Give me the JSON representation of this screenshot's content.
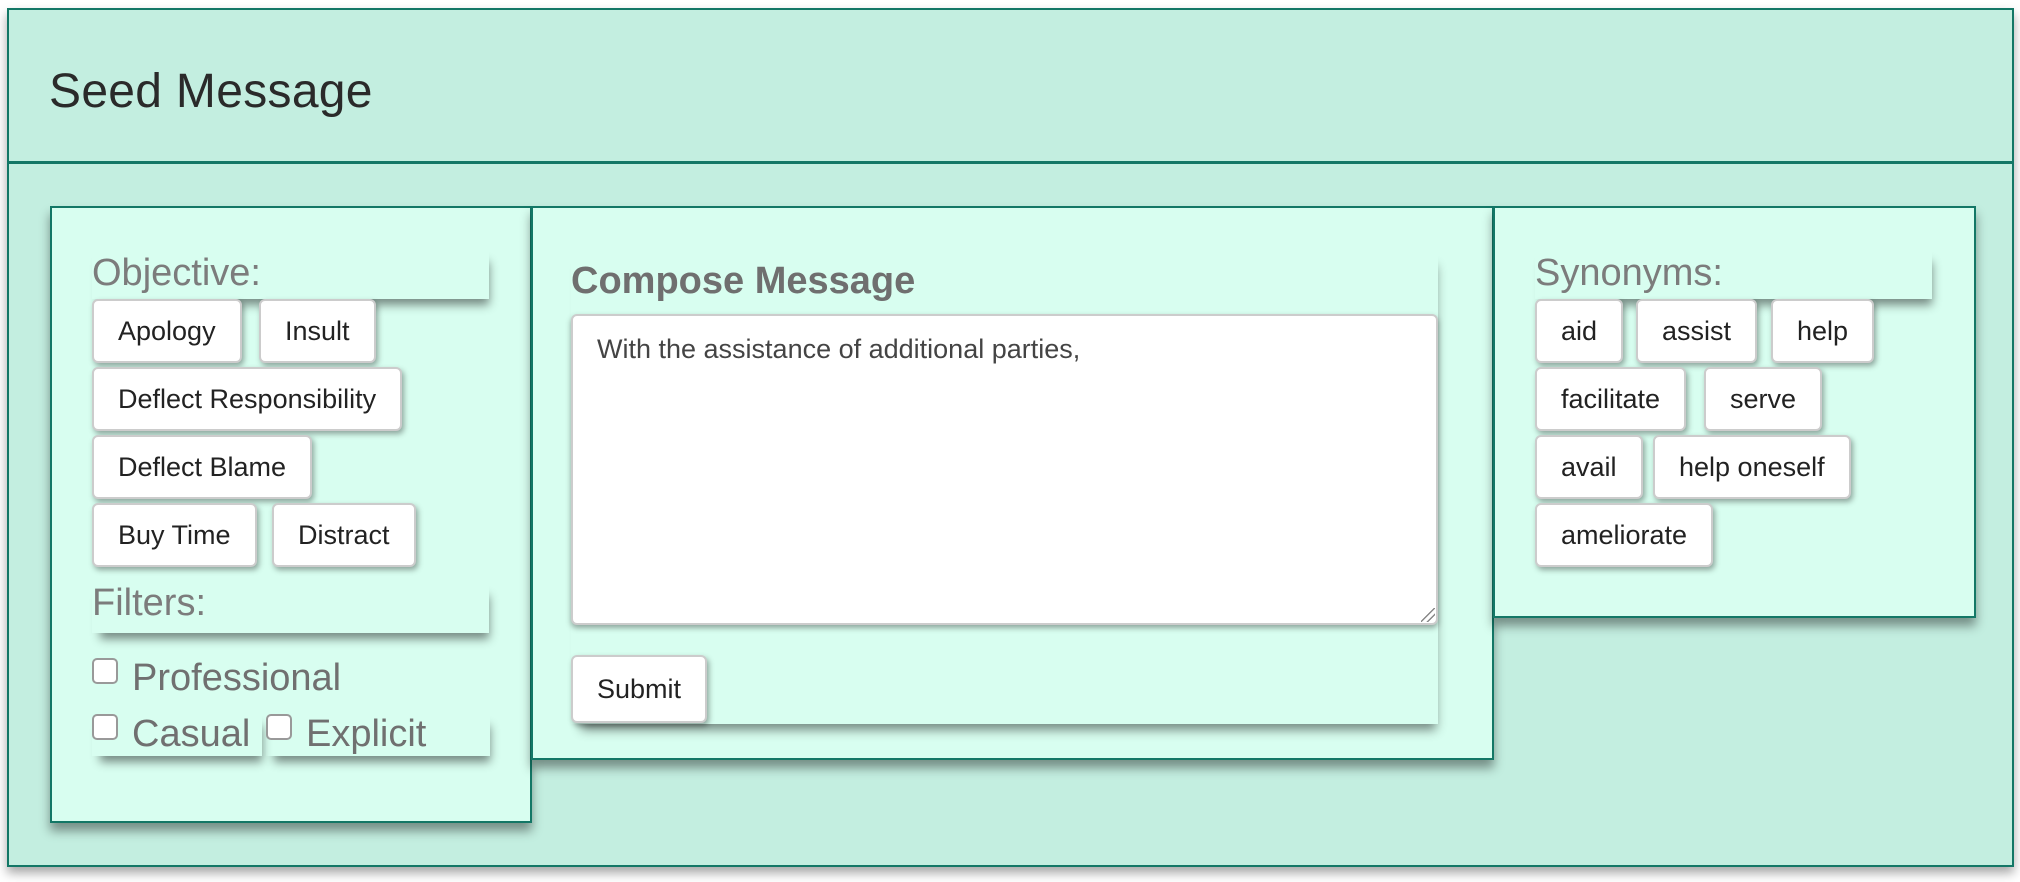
{
  "header": {
    "title": "Seed Message"
  },
  "objective": {
    "label": "Objective:",
    "options": [
      "Apology",
      "Insult",
      "Deflect Responsibility",
      "Deflect Blame",
      "Buy Time",
      "Distract"
    ]
  },
  "filters": {
    "label": "Filters:",
    "options": [
      {
        "label": "Professional",
        "checked": false
      },
      {
        "label": "Casual",
        "checked": false
      },
      {
        "label": "Explicit",
        "checked": false
      }
    ]
  },
  "compose": {
    "title": "Compose Message",
    "message": "With the assistance of additional parties,",
    "submit_label": "Submit"
  },
  "synonyms": {
    "label": "Synonyms:",
    "items": [
      "aid",
      "assist",
      "help",
      "facilitate",
      "serve",
      "avail",
      "help oneself",
      "ameliorate"
    ]
  },
  "colors": {
    "background": "#c3eee0",
    "panel": "#d8fef0",
    "border": "#137766",
    "label_text": "#7c7c7c"
  }
}
